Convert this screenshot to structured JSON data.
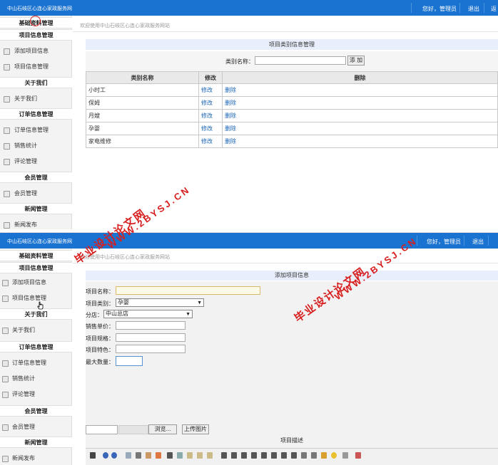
{
  "site_title": "中山石岐区心连心家政服务网",
  "header": {
    "greeting": "您好，管理员",
    "logout": "退出",
    "extra": "返"
  },
  "sidebar": {
    "sections": [
      {
        "title": "基础资料管理",
        "items": []
      },
      {
        "title": "项目信息管理",
        "items": [
          "添加项目信息",
          "项目信息管理"
        ]
      },
      {
        "title": "关于我们",
        "items": [
          "关于我们"
        ]
      },
      {
        "title": "订单信息管理",
        "items": [
          "订单信息管理",
          "销售统计",
          "评论管理"
        ]
      },
      {
        "title": "会员管理",
        "items": [
          "会员管理"
        ]
      },
      {
        "title": "新闻管理",
        "items": [
          "新闻发布"
        ]
      }
    ]
  },
  "breadcrumb": "欢迎使用中山石岐区心连心家政服务网站",
  "category_page": {
    "title": "项目类别信息管理",
    "search_label": "类别名称：",
    "search_value": "",
    "add_button": "添 加",
    "columns": [
      "类别名称",
      "修改",
      "删除"
    ],
    "rows": [
      {
        "name": "小时工",
        "edit": "修改",
        "delete": "删除"
      },
      {
        "name": "保姆",
        "edit": "修改",
        "delete": "删除"
      },
      {
        "name": "月嫂",
        "edit": "修改",
        "delete": "删除"
      },
      {
        "name": "孕婴",
        "edit": "修改",
        "delete": "删除"
      },
      {
        "name": "家电维修",
        "edit": "修改",
        "delete": "删除"
      }
    ]
  },
  "add_page": {
    "title": "添加项目信息",
    "fields": {
      "name_label": "项目名称：",
      "type_label": "项目类别：",
      "type_value": "孕婴",
      "store_label": "分店：",
      "store_value": "中山总店",
      "price_label": "销售单价：",
      "spec_label": "项目规格：",
      "feature_label": "项目特色：",
      "max_label": "最大数量："
    },
    "browse_button": "浏览...",
    "upload_button": "上传图片",
    "desc_label": "项目描述"
  },
  "watermark": {
    "line1": "毕业设计论文网",
    "line2": "WWW.2BYSJ.CN"
  },
  "colors": {
    "topbar": "#1b73d1",
    "panel_title": "#e8eefc",
    "watermark": "#d81e1e",
    "link": "#1a64b5"
  },
  "icons": [
    "item-icon",
    "cursor-hand-icon",
    "editor-toolbar-icons"
  ]
}
